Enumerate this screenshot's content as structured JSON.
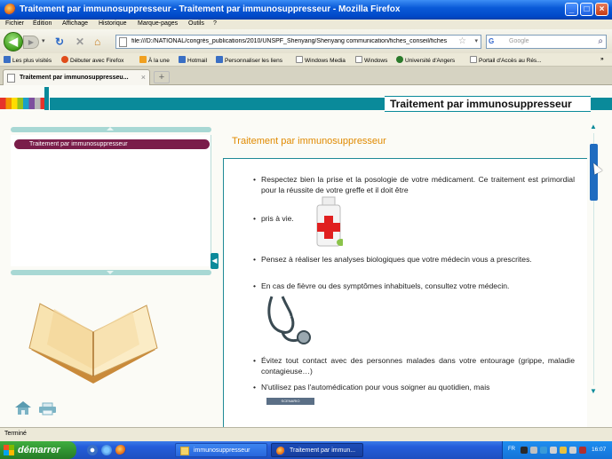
{
  "window": {
    "title": "Traitement par immunosuppresseur - Traitement par immunosuppresseur - Mozilla Firefox",
    "buttons": {
      "minimize": "_",
      "maximize": "□",
      "close": "×"
    }
  },
  "menu": [
    "Fichier",
    "Édition",
    "Affichage",
    "Historique",
    "Marque-pages",
    "Outils",
    "?"
  ],
  "navbar": {
    "url": "file:///D:/NATIONAL/congrès_publications/2010/UNSPF_Shenyang/Shenyang communication/fiches_conseil/fiches",
    "search_placeholder": "Google",
    "search_engine_label": "G"
  },
  "bookmarks": [
    {
      "label": "Les plus visités",
      "color": "#3a6fc4"
    },
    {
      "label": "Débuter avec Firefox",
      "color": "#e04c1a"
    },
    {
      "label": "À la une",
      "color": "#f0a020"
    },
    {
      "label": "Hotmail",
      "color": "#3a6fc4"
    },
    {
      "label": "Personnaliser les liens",
      "color": "#3a6fc4"
    },
    {
      "label": "Windows Media",
      "color": "#ffffff"
    },
    {
      "label": "Windows",
      "color": "#ffffff"
    },
    {
      "label": "Université d'Angers",
      "color": "#2b7a2b"
    },
    {
      "label": "Portail d'Accès au Rés...",
      "color": "#ffffff"
    }
  ],
  "tabs": [
    {
      "label": "Traitement par immunosuppresseu...",
      "active": true
    }
  ],
  "new_tab_label": "+",
  "page": {
    "header_title": "Traitement par immunosuppresseur",
    "left_menu": {
      "selected_item": "Traitement par immunosuppresseur",
      "collapse_tab": "◀"
    },
    "content_title": "Traitement par immunosuppresseur",
    "bullets": [
      "Respectez bien la prise et la posologie de votre médicament. Ce traitement est primordial pour la réussite de votre greffe et il doit être",
      "pris à vie.",
      "Pensez à réaliser les analyses biologiques que votre médecin vous a prescrites.",
      "En cas de fièvre ou des symptômes inhabituels, consultez votre médecin.",
      "Évitez tout contact avec des personnes malades dans votre entourage (grippe, maladie contagieuse…)",
      "N'utilisez pas l'automédication pour vous soigner au quotidien, mais"
    ],
    "inline_link": "SCENARIO",
    "colors": {
      "teal": "#0a8a9a",
      "orange_title": "#e08a00",
      "menu_selected": "#7a1d4a"
    }
  },
  "status": "Terminé",
  "taskbar": {
    "start_label": "démarrer",
    "tasks": [
      {
        "label": "immunosuppresseur",
        "active": false
      },
      {
        "label": "Traitement par immun...",
        "active": true
      }
    ],
    "tray": {
      "language": "FR",
      "time": "16:07"
    }
  }
}
